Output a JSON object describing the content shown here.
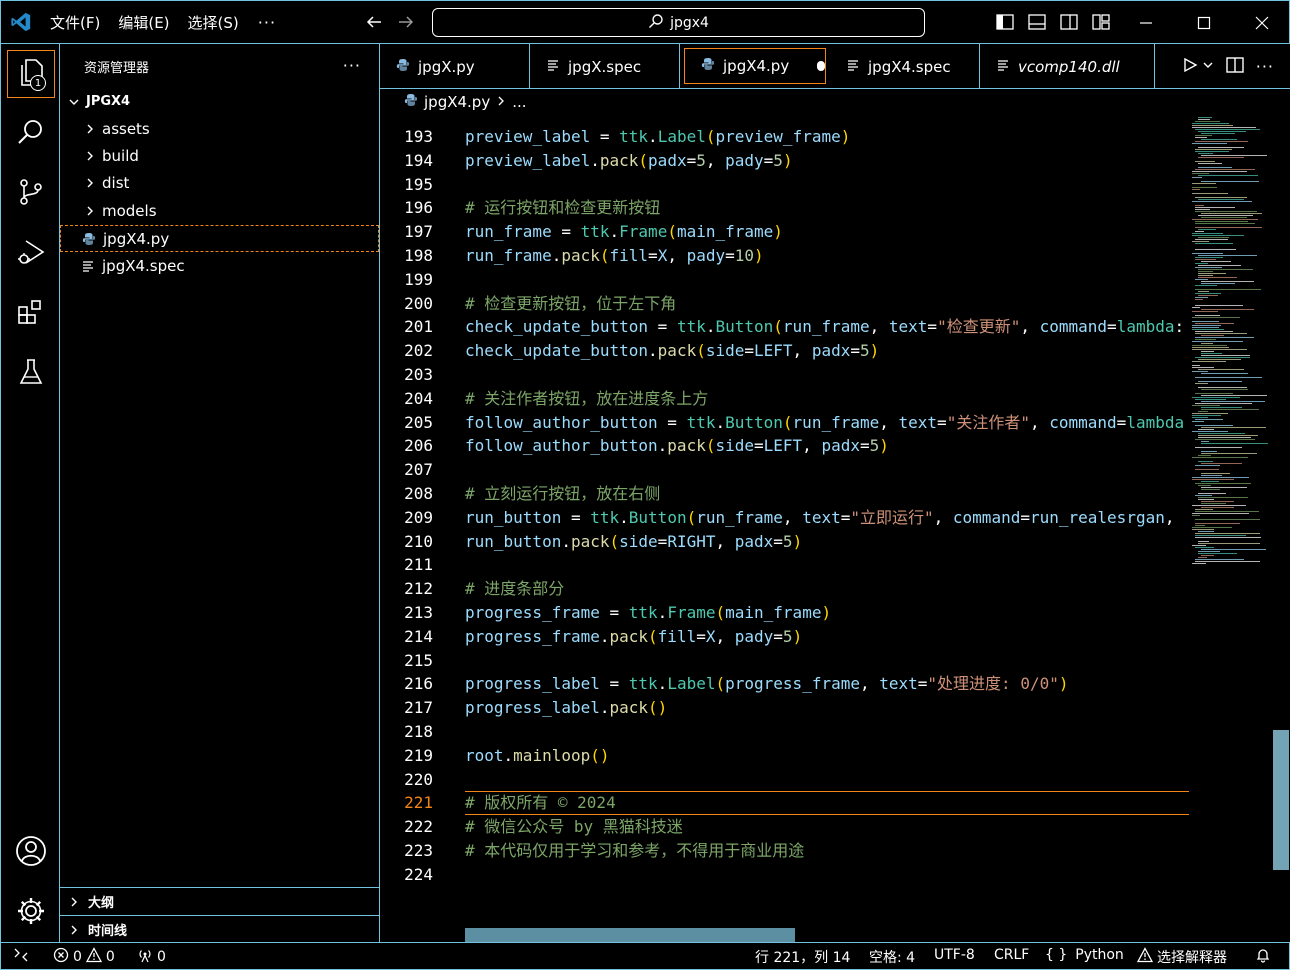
{
  "titlebar": {
    "menus": [
      "文件(F)",
      "编辑(E)",
      "选择(S)"
    ],
    "more": "···",
    "search_text": "jpgx4"
  },
  "activity": {
    "explorer_badge": "1"
  },
  "sidebar": {
    "title": "资源管理器",
    "more": "···",
    "root": "JPGX4",
    "items": [
      {
        "label": "assets",
        "type": "folder"
      },
      {
        "label": "build",
        "type": "folder"
      },
      {
        "label": "dist",
        "type": "folder"
      },
      {
        "label": "models",
        "type": "folder"
      },
      {
        "label": "jpgX4.py",
        "type": "python"
      },
      {
        "label": "jpgX4.spec",
        "type": "text"
      }
    ],
    "sections": [
      "大纲",
      "时间线"
    ]
  },
  "tabs": [
    {
      "label": "jpgX.py",
      "icon": "python-icon"
    },
    {
      "label": "jpgX.spec",
      "icon": "text-file-icon"
    },
    {
      "label": "jpgX4.py",
      "icon": "python-icon"
    },
    {
      "label": "jpgX4.spec",
      "icon": "text-file-icon"
    },
    {
      "label": "vcomp140.dll",
      "icon": "text-file-icon"
    }
  ],
  "breadcrumb": {
    "file": "jpgX4.py",
    "rest": "..."
  },
  "editor": {
    "lines": [
      {
        "n": "193",
        "tokens": [
          [
            "v",
            "preview_label"
          ],
          [
            "w",
            " = "
          ],
          [
            "t",
            "ttk"
          ],
          [
            "w",
            "."
          ],
          [
            "t",
            "Label"
          ],
          [
            "p",
            "("
          ],
          [
            "v",
            "preview_frame"
          ],
          [
            "p",
            ")"
          ]
        ]
      },
      {
        "n": "194",
        "tokens": [
          [
            "v",
            "preview_label"
          ],
          [
            "w",
            "."
          ],
          [
            "f",
            "pack"
          ],
          [
            "p",
            "("
          ],
          [
            "v",
            "padx"
          ],
          [
            "w",
            "="
          ],
          [
            "n",
            "5"
          ],
          [
            "w",
            ", "
          ],
          [
            "v",
            "pady"
          ],
          [
            "w",
            "="
          ],
          [
            "n",
            "5"
          ],
          [
            "p",
            ")"
          ]
        ]
      },
      {
        "n": "195",
        "tokens": []
      },
      {
        "n": "196",
        "tokens": [
          [
            "c",
            "# 运行按钮和检查更新按钮"
          ]
        ]
      },
      {
        "n": "197",
        "tokens": [
          [
            "v",
            "run_frame"
          ],
          [
            "w",
            " = "
          ],
          [
            "t",
            "ttk"
          ],
          [
            "w",
            "."
          ],
          [
            "t",
            "Frame"
          ],
          [
            "p",
            "("
          ],
          [
            "v",
            "main_frame"
          ],
          [
            "p",
            ")"
          ]
        ]
      },
      {
        "n": "198",
        "tokens": [
          [
            "v",
            "run_frame"
          ],
          [
            "w",
            "."
          ],
          [
            "f",
            "pack"
          ],
          [
            "p",
            "("
          ],
          [
            "v",
            "fill"
          ],
          [
            "w",
            "="
          ],
          [
            "v",
            "X"
          ],
          [
            "w",
            ", "
          ],
          [
            "v",
            "pady"
          ],
          [
            "w",
            "="
          ],
          [
            "n",
            "10"
          ],
          [
            "p",
            ")"
          ]
        ]
      },
      {
        "n": "199",
        "tokens": []
      },
      {
        "n": "200",
        "tokens": [
          [
            "c",
            "# 检查更新按钮，位于左下角"
          ]
        ]
      },
      {
        "n": "201",
        "tokens": [
          [
            "v",
            "check_update_button"
          ],
          [
            "w",
            " = "
          ],
          [
            "t",
            "ttk"
          ],
          [
            "w",
            "."
          ],
          [
            "t",
            "Button"
          ],
          [
            "p",
            "("
          ],
          [
            "v",
            "run_frame"
          ],
          [
            "w",
            ", "
          ],
          [
            "v",
            "text"
          ],
          [
            "w",
            "="
          ],
          [
            "s",
            "\"检查更新\""
          ],
          [
            "w",
            ", "
          ],
          [
            "v",
            "command"
          ],
          [
            "w",
            "="
          ],
          [
            "t",
            "lambda"
          ],
          [
            "w",
            ":"
          ]
        ]
      },
      {
        "n": "202",
        "tokens": [
          [
            "v",
            "check_update_button"
          ],
          [
            "w",
            "."
          ],
          [
            "f",
            "pack"
          ],
          [
            "p",
            "("
          ],
          [
            "v",
            "side"
          ],
          [
            "w",
            "="
          ],
          [
            "v",
            "LEFT"
          ],
          [
            "w",
            ", "
          ],
          [
            "v",
            "padx"
          ],
          [
            "w",
            "="
          ],
          [
            "n",
            "5"
          ],
          [
            "p",
            ")"
          ]
        ]
      },
      {
        "n": "203",
        "tokens": []
      },
      {
        "n": "204",
        "tokens": [
          [
            "c",
            "# 关注作者按钮，放在进度条上方"
          ]
        ]
      },
      {
        "n": "205",
        "tokens": [
          [
            "v",
            "follow_author_button"
          ],
          [
            "w",
            " = "
          ],
          [
            "t",
            "ttk"
          ],
          [
            "w",
            "."
          ],
          [
            "t",
            "Button"
          ],
          [
            "p",
            "("
          ],
          [
            "v",
            "run_frame"
          ],
          [
            "w",
            ", "
          ],
          [
            "v",
            "text"
          ],
          [
            "w",
            "="
          ],
          [
            "s",
            "\"关注作者\""
          ],
          [
            "w",
            ", "
          ],
          [
            "v",
            "command"
          ],
          [
            "w",
            "="
          ],
          [
            "t",
            "lambda"
          ]
        ]
      },
      {
        "n": "206",
        "tokens": [
          [
            "v",
            "follow_author_button"
          ],
          [
            "w",
            "."
          ],
          [
            "f",
            "pack"
          ],
          [
            "p",
            "("
          ],
          [
            "v",
            "side"
          ],
          [
            "w",
            "="
          ],
          [
            "v",
            "LEFT"
          ],
          [
            "w",
            ", "
          ],
          [
            "v",
            "padx"
          ],
          [
            "w",
            "="
          ],
          [
            "n",
            "5"
          ],
          [
            "p",
            ")"
          ]
        ]
      },
      {
        "n": "207",
        "tokens": []
      },
      {
        "n": "208",
        "tokens": [
          [
            "c",
            "# 立刻运行按钮，放在右侧"
          ]
        ]
      },
      {
        "n": "209",
        "tokens": [
          [
            "v",
            "run_button"
          ],
          [
            "w",
            " = "
          ],
          [
            "t",
            "ttk"
          ],
          [
            "w",
            "."
          ],
          [
            "t",
            "Button"
          ],
          [
            "p",
            "("
          ],
          [
            "v",
            "run_frame"
          ],
          [
            "w",
            ", "
          ],
          [
            "v",
            "text"
          ],
          [
            "w",
            "="
          ],
          [
            "s",
            "\"立即运行\""
          ],
          [
            "w",
            ", "
          ],
          [
            "v",
            "command"
          ],
          [
            "w",
            "="
          ],
          [
            "v",
            "run_realesrgan"
          ],
          [
            "w",
            ","
          ]
        ]
      },
      {
        "n": "210",
        "tokens": [
          [
            "v",
            "run_button"
          ],
          [
            "w",
            "."
          ],
          [
            "f",
            "pack"
          ],
          [
            "p",
            "("
          ],
          [
            "v",
            "side"
          ],
          [
            "w",
            "="
          ],
          [
            "v",
            "RIGHT"
          ],
          [
            "w",
            ", "
          ],
          [
            "v",
            "padx"
          ],
          [
            "w",
            "="
          ],
          [
            "n",
            "5"
          ],
          [
            "p",
            ")"
          ]
        ]
      },
      {
        "n": "211",
        "tokens": []
      },
      {
        "n": "212",
        "tokens": [
          [
            "c",
            "# 进度条部分"
          ]
        ]
      },
      {
        "n": "213",
        "tokens": [
          [
            "v",
            "progress_frame"
          ],
          [
            "w",
            " = "
          ],
          [
            "t",
            "ttk"
          ],
          [
            "w",
            "."
          ],
          [
            "t",
            "Frame"
          ],
          [
            "p",
            "("
          ],
          [
            "v",
            "main_frame"
          ],
          [
            "p",
            ")"
          ]
        ]
      },
      {
        "n": "214",
        "tokens": [
          [
            "v",
            "progress_frame"
          ],
          [
            "w",
            "."
          ],
          [
            "f",
            "pack"
          ],
          [
            "p",
            "("
          ],
          [
            "v",
            "fill"
          ],
          [
            "w",
            "="
          ],
          [
            "v",
            "X"
          ],
          [
            "w",
            ", "
          ],
          [
            "v",
            "pady"
          ],
          [
            "w",
            "="
          ],
          [
            "n",
            "5"
          ],
          [
            "p",
            ")"
          ]
        ]
      },
      {
        "n": "215",
        "tokens": []
      },
      {
        "n": "216",
        "tokens": [
          [
            "v",
            "progress_label"
          ],
          [
            "w",
            " = "
          ],
          [
            "t",
            "ttk"
          ],
          [
            "w",
            "."
          ],
          [
            "t",
            "Label"
          ],
          [
            "p",
            "("
          ],
          [
            "v",
            "progress_frame"
          ],
          [
            "w",
            ", "
          ],
          [
            "v",
            "text"
          ],
          [
            "w",
            "="
          ],
          [
            "s",
            "\"处理进度: 0/0\""
          ],
          [
            "p",
            ")"
          ]
        ]
      },
      {
        "n": "217",
        "tokens": [
          [
            "v",
            "progress_label"
          ],
          [
            "w",
            "."
          ],
          [
            "f",
            "pack"
          ],
          [
            "p",
            "()"
          ]
        ]
      },
      {
        "n": "218",
        "tokens": []
      },
      {
        "n": "219",
        "tokens": [
          [
            "v",
            "root"
          ],
          [
            "w",
            "."
          ],
          [
            "f",
            "mainloop"
          ],
          [
            "p",
            "()"
          ]
        ]
      },
      {
        "n": "220",
        "tokens": []
      },
      {
        "n": "221",
        "tokens": [
          [
            "c",
            "# 版权所有 © 2024"
          ]
        ],
        "current": true
      },
      {
        "n": "222",
        "tokens": [
          [
            "c",
            "# 微信公众号 by 黑猫科技迷"
          ]
        ]
      },
      {
        "n": "223",
        "tokens": [
          [
            "c",
            "# 本代码仅用于学习和参考，不得用于商业用途"
          ]
        ]
      },
      {
        "n": "224",
        "tokens": []
      }
    ]
  },
  "statusbar": {
    "errors": "0",
    "warnings": "0",
    "ports": "0",
    "position": "行 221，列 14",
    "spaces": "空格: 4",
    "encoding": "UTF-8",
    "eol": "CRLF",
    "language_icon": "{ }",
    "language": "Python",
    "interpreter": "选择解释器"
  },
  "colors": {
    "contrast_border": "#6fc3df",
    "active_border": "#f38518"
  }
}
